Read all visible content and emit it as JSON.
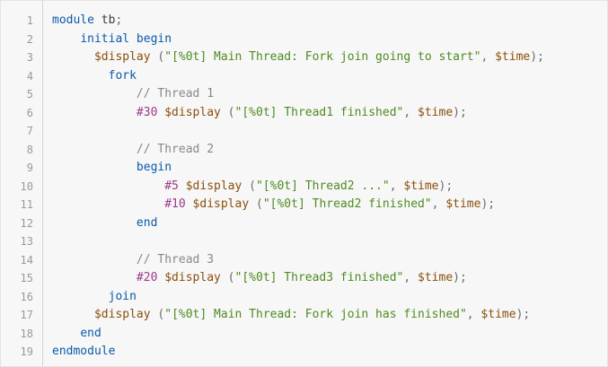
{
  "code": {
    "lines": [
      {
        "n": "1",
        "t": [
          {
            "c": "kw",
            "v": "module"
          },
          {
            "c": "plain",
            "v": " tb"
          },
          {
            "c": "pun",
            "v": ";"
          }
        ]
      },
      {
        "n": "2",
        "t": [
          {
            "c": "plain",
            "v": "    "
          },
          {
            "c": "kw",
            "v": "initial begin"
          }
        ]
      },
      {
        "n": "3",
        "t": [
          {
            "c": "plain",
            "v": "      "
          },
          {
            "c": "sys",
            "v": "$display"
          },
          {
            "c": "pun",
            "v": " ("
          },
          {
            "c": "str",
            "v": "\"[%0t] Main Thread: Fork join going to start\""
          },
          {
            "c": "pun",
            "v": ", "
          },
          {
            "c": "sys",
            "v": "$time"
          },
          {
            "c": "pun",
            "v": ");"
          }
        ]
      },
      {
        "n": "4",
        "t": [
          {
            "c": "plain",
            "v": "        "
          },
          {
            "c": "kw",
            "v": "fork"
          }
        ]
      },
      {
        "n": "5",
        "t": [
          {
            "c": "plain",
            "v": "            "
          },
          {
            "c": "com",
            "v": "// Thread 1"
          }
        ]
      },
      {
        "n": "6",
        "t": [
          {
            "c": "plain",
            "v": "            "
          },
          {
            "c": "num",
            "v": "#30"
          },
          {
            "c": "plain",
            "v": " "
          },
          {
            "c": "sys",
            "v": "$display"
          },
          {
            "c": "pun",
            "v": " ("
          },
          {
            "c": "str",
            "v": "\"[%0t] Thread1 finished\""
          },
          {
            "c": "pun",
            "v": ", "
          },
          {
            "c": "sys",
            "v": "$time"
          },
          {
            "c": "pun",
            "v": ");"
          }
        ]
      },
      {
        "n": "7",
        "t": []
      },
      {
        "n": "8",
        "t": [
          {
            "c": "plain",
            "v": "            "
          },
          {
            "c": "com",
            "v": "// Thread 2"
          }
        ]
      },
      {
        "n": "9",
        "t": [
          {
            "c": "plain",
            "v": "            "
          },
          {
            "c": "kw",
            "v": "begin"
          }
        ]
      },
      {
        "n": "10",
        "t": [
          {
            "c": "plain",
            "v": "                "
          },
          {
            "c": "num",
            "v": "#5"
          },
          {
            "c": "plain",
            "v": " "
          },
          {
            "c": "sys",
            "v": "$display"
          },
          {
            "c": "pun",
            "v": " ("
          },
          {
            "c": "str",
            "v": "\"[%0t] Thread2 ...\""
          },
          {
            "c": "pun",
            "v": ", "
          },
          {
            "c": "sys",
            "v": "$time"
          },
          {
            "c": "pun",
            "v": ");"
          }
        ]
      },
      {
        "n": "11",
        "t": [
          {
            "c": "plain",
            "v": "                "
          },
          {
            "c": "num",
            "v": "#10"
          },
          {
            "c": "plain",
            "v": " "
          },
          {
            "c": "sys",
            "v": "$display"
          },
          {
            "c": "pun",
            "v": " ("
          },
          {
            "c": "str",
            "v": "\"[%0t] Thread2 finished\""
          },
          {
            "c": "pun",
            "v": ", "
          },
          {
            "c": "sys",
            "v": "$time"
          },
          {
            "c": "pun",
            "v": ");"
          }
        ]
      },
      {
        "n": "12",
        "t": [
          {
            "c": "plain",
            "v": "            "
          },
          {
            "c": "kw",
            "v": "end"
          }
        ]
      },
      {
        "n": "13",
        "t": []
      },
      {
        "n": "14",
        "t": [
          {
            "c": "plain",
            "v": "            "
          },
          {
            "c": "com",
            "v": "// Thread 3"
          }
        ]
      },
      {
        "n": "15",
        "t": [
          {
            "c": "plain",
            "v": "            "
          },
          {
            "c": "num",
            "v": "#20"
          },
          {
            "c": "plain",
            "v": " "
          },
          {
            "c": "sys",
            "v": "$display"
          },
          {
            "c": "pun",
            "v": " ("
          },
          {
            "c": "str",
            "v": "\"[%0t] Thread3 finished\""
          },
          {
            "c": "pun",
            "v": ", "
          },
          {
            "c": "sys",
            "v": "$time"
          },
          {
            "c": "pun",
            "v": ");"
          }
        ]
      },
      {
        "n": "16",
        "t": [
          {
            "c": "plain",
            "v": "        "
          },
          {
            "c": "kw",
            "v": "join"
          }
        ]
      },
      {
        "n": "17",
        "t": [
          {
            "c": "plain",
            "v": "      "
          },
          {
            "c": "sys",
            "v": "$display"
          },
          {
            "c": "pun",
            "v": " ("
          },
          {
            "c": "str",
            "v": "\"[%0t] Main Thread: Fork join has finished\""
          },
          {
            "c": "pun",
            "v": ", "
          },
          {
            "c": "sys",
            "v": "$time"
          },
          {
            "c": "pun",
            "v": ");"
          }
        ]
      },
      {
        "n": "18",
        "t": [
          {
            "c": "plain",
            "v": "    "
          },
          {
            "c": "kw",
            "v": "end"
          }
        ]
      },
      {
        "n": "19",
        "t": [
          {
            "c": "kw",
            "v": "endmodule"
          }
        ]
      }
    ]
  },
  "colors": {
    "background": "#f7f7f7",
    "keyword": "#0a5aa8",
    "string": "#4d8b1f",
    "system_task": "#8a4f0a",
    "comment": "#888888",
    "line_number": "#999999"
  }
}
